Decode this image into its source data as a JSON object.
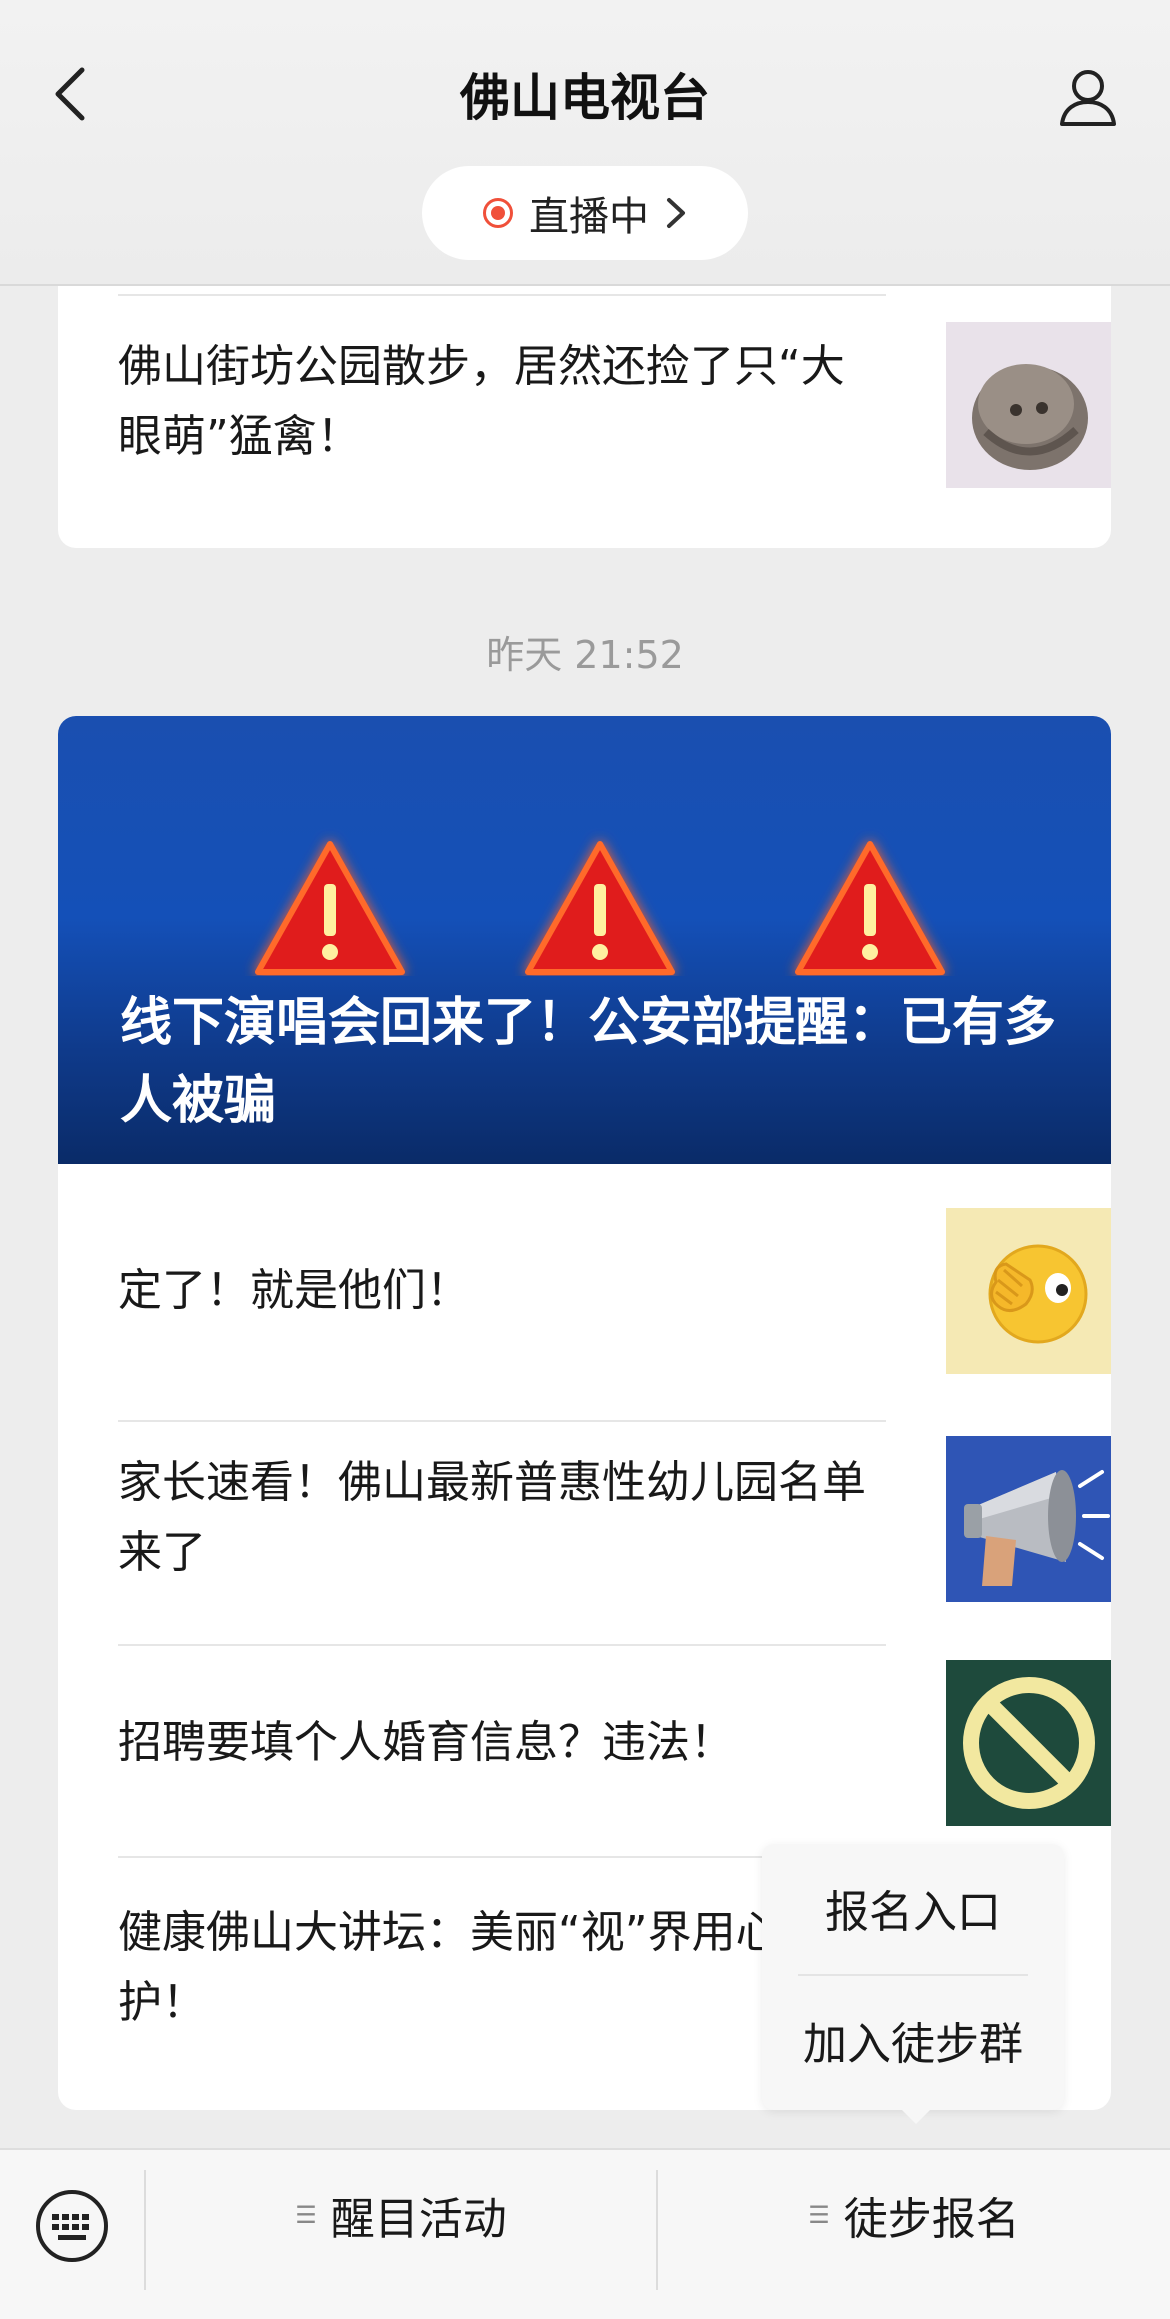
{
  "header": {
    "title": "佛山电视台",
    "live_label": "直播中"
  },
  "feed": {
    "card1": {
      "items": [
        {
          "text": "佛山街坊公园散步，居然还捡了只“大眼萌”猛禽！",
          "thumb": "owl-chick-photo"
        }
      ]
    },
    "timestamp": "昨天 21:52",
    "card2": {
      "cover_title": "线下演唱会回来了！公安部提醒：已有多人被骗",
      "items": [
        {
          "text": "定了！就是他们！",
          "thumb": "face-palm-emoji"
        },
        {
          "text": "家长速看！佛山最新普惠性幼儿园名单来了",
          "thumb": "megaphone-image"
        },
        {
          "text": "招聘要填个人婚育信息？违法！",
          "thumb": "prohibited-sign"
        },
        {
          "text": "健康佛山大讲坛：美丽“视”界用心呵护！"
        }
      ]
    }
  },
  "popup": {
    "items": [
      "报名入口",
      "加入徒步群"
    ]
  },
  "bottom_bar": {
    "menus": [
      "醒目活动",
      "徒步报名"
    ]
  },
  "colors": {
    "live_red": "#f0503a",
    "cover_blue": "#1450b8",
    "warning_red": "#e01e1e",
    "prohibited_green": "#1e4a3c",
    "prohibited_yellow": "#f2e8a0"
  }
}
